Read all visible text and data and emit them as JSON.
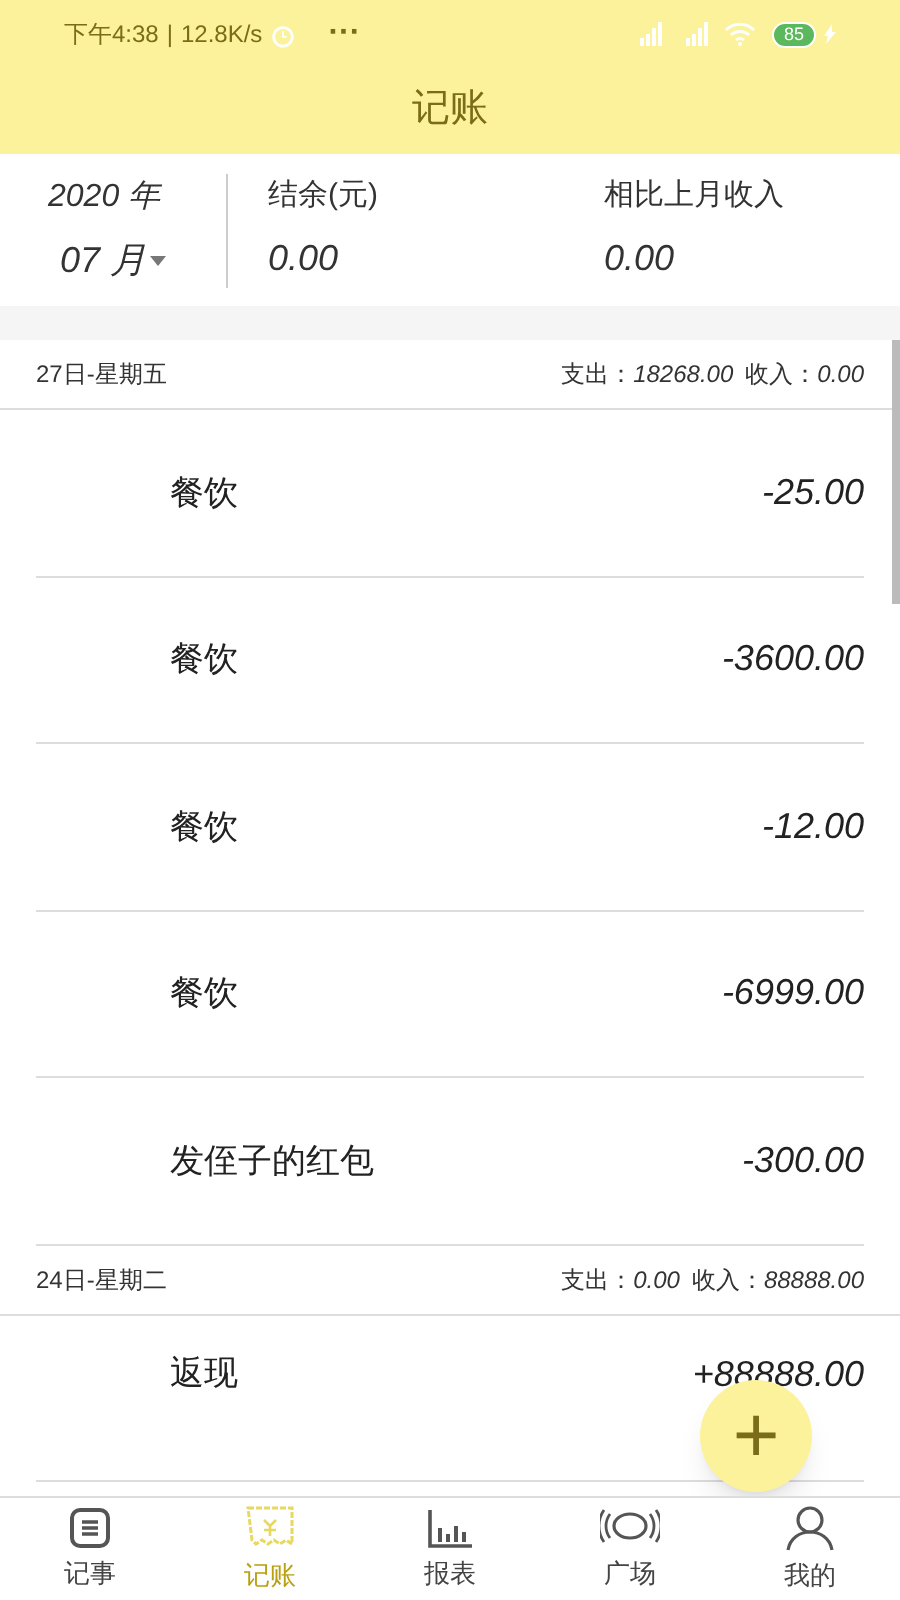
{
  "status_bar": {
    "time": "下午4:38",
    "separator": "|",
    "speed": "12.8K/s",
    "dots": "···",
    "battery": "85"
  },
  "title": "记账",
  "summary": {
    "year": "2020 年",
    "month": "07 月",
    "balance_label": "结余(元)",
    "balance": "0.00",
    "compare_label": "相比上月收入",
    "compare": "0.00"
  },
  "groups": [
    {
      "date": "27日-星期五",
      "expense_label": "支出：",
      "expense": "18268.00",
      "income_label": "收入：",
      "income": "0.00",
      "entries": [
        {
          "category": "餐饮",
          "amount": "-25.00"
        },
        {
          "category": "餐饮",
          "amount": "-3600.00"
        },
        {
          "category": "餐饮",
          "amount": "-12.00"
        },
        {
          "category": "餐饮",
          "amount": "-6999.00"
        },
        {
          "category": "发侄子的红包",
          "amount": "-300.00"
        }
      ]
    },
    {
      "date": "24日-星期二",
      "expense_label": "支出：",
      "expense": "0.00",
      "income_label": "收入：",
      "income": "88888.00",
      "entries": [
        {
          "category": "返现",
          "amount": "+88888.00"
        }
      ]
    }
  ],
  "add_button": "+",
  "tabs": [
    {
      "label": "记事",
      "selected": false
    },
    {
      "label": "记账",
      "selected": true
    },
    {
      "label": "报表",
      "selected": false
    },
    {
      "label": "广场",
      "selected": false
    },
    {
      "label": "我的",
      "selected": false
    }
  ]
}
